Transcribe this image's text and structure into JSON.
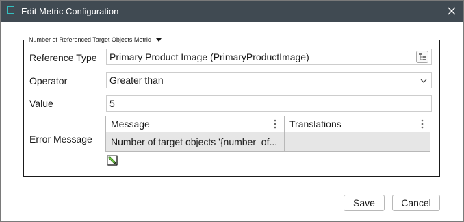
{
  "window": {
    "title": "Edit Metric Configuration",
    "icon": "app-window-icon",
    "close_icon": "close-icon"
  },
  "group": {
    "legend": "Number of Referenced Target Objects Metric"
  },
  "form": {
    "reference_type": {
      "label": "Reference Type",
      "value": "Primary Product Image (PrimaryProductImage)",
      "picker_icon": "reference-picker-icon"
    },
    "operator": {
      "label": "Operator",
      "value": "Greater than"
    },
    "value": {
      "label": "Value",
      "value": "5"
    },
    "error_message": {
      "label": "Error Message",
      "columns": [
        "Message",
        "Translations"
      ],
      "rows": [
        {
          "message": "Number of target objects '{number_of...",
          "translations": ""
        }
      ],
      "edit_icon": "edit-pencil-icon"
    }
  },
  "footer": {
    "save_label": "Save",
    "cancel_label": "Cancel"
  },
  "colors": {
    "titlebar_bg": "#404a52",
    "title_text": "#ffffff",
    "accent_icon": "#33c0c0",
    "row_bg": "#e6e6e6"
  }
}
